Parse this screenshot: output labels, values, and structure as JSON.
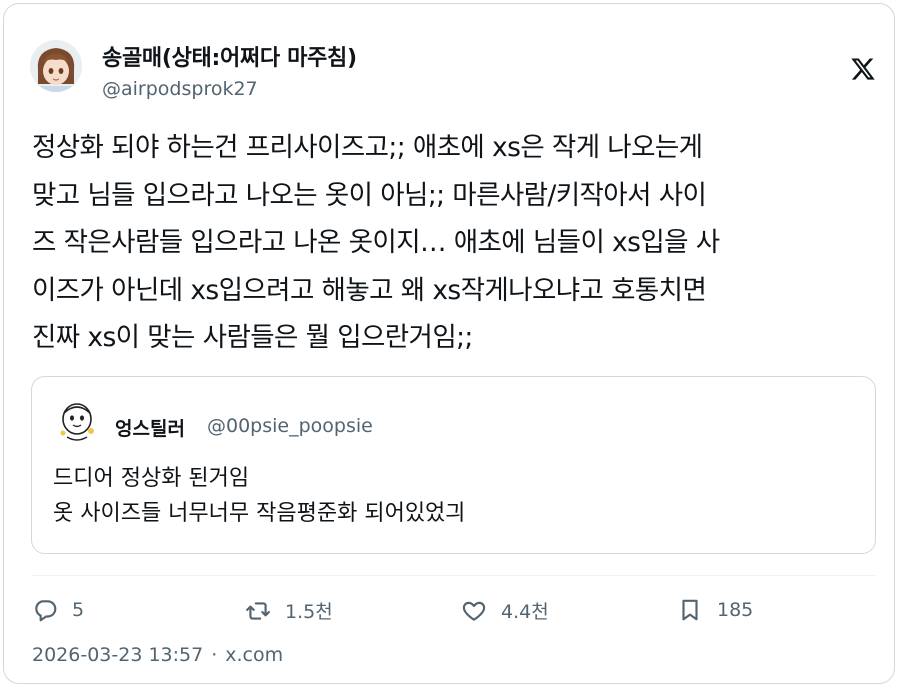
{
  "author": {
    "display_name": "송골매(상태:어쩌다 마주침)",
    "handle": "@airpodsprok27",
    "avatar_icon": "anime-avatar-icon"
  },
  "tweet": {
    "text": "정상화 되야 하는건 프리사이즈고;; 애초에 xs은 작게 나오는게\n맞고 님들 입으라고 나오는 옷이 아님;; 마른사람/키작아서 사이\n즈 작은사람들 입으라고 나온 옷이지… 애초에 님들이 xs입을 사\n이즈가 아닌데 xs입으려고 해놓고 왜 xs작게나오냐고 호통치면\n진짜 xs이 맞는 사람들은 뭘 입으란거임;;"
  },
  "quote": {
    "display_name": "엉스틸러",
    "handle": "@00psie_poopsie",
    "text": "드디어 정상화 된거임\n옷 사이즈들 너무너무 작음평준화 되어있었긔"
  },
  "metrics": {
    "replies": "5",
    "retweets": "1.5천",
    "likes": "4.4천",
    "bookmarks": "185"
  },
  "footer": {
    "timestamp": "2026-03-23 13:57",
    "separator": "·",
    "source": "x.com"
  },
  "colors": {
    "text": "#0f1419",
    "secondary": "#536471",
    "border": "#cfd9de"
  }
}
